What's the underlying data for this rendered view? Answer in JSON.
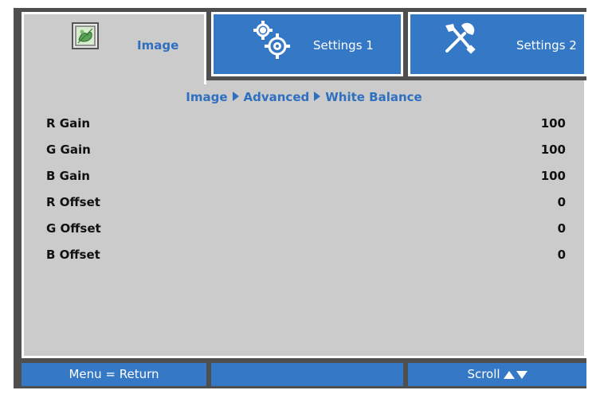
{
  "tabs": [
    {
      "label": "Image",
      "icon": "image-icon",
      "active": true
    },
    {
      "label": "Settings 1",
      "icon": "gears-icon",
      "active": false
    },
    {
      "label": "Settings 2",
      "icon": "tools-icon",
      "active": false
    }
  ],
  "breadcrumb": {
    "items": [
      "Image",
      "Advanced",
      "White Balance"
    ]
  },
  "settings": [
    {
      "name": "R Gain",
      "value": "100"
    },
    {
      "name": "G Gain",
      "value": "100"
    },
    {
      "name": "B Gain",
      "value": "100"
    },
    {
      "name": "R Offset",
      "value": "0"
    },
    {
      "name": "G Offset",
      "value": "0"
    },
    {
      "name": "B Offset",
      "value": "0"
    }
  ],
  "footer": {
    "left": "Menu = Return",
    "middle": "",
    "right": "Scroll"
  },
  "colors": {
    "accent": "#3578c5",
    "panel": "#cbcbcb",
    "frame": "#4f4f4f",
    "breadcrumb_text": "#2f6fc0"
  }
}
